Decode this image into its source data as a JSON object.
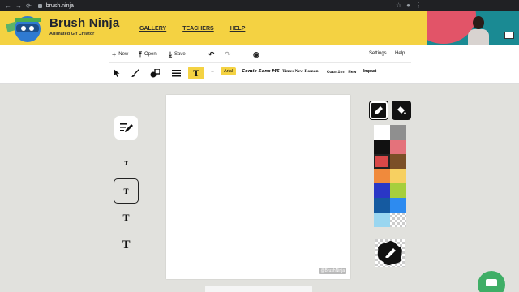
{
  "browser": {
    "url": "brush.ninja"
  },
  "brand": {
    "name": "Brush Ninja",
    "tagline": "Animated Gif Creator"
  },
  "nav": [
    {
      "label": "GALLERY"
    },
    {
      "label": "TEACHERS"
    },
    {
      "label": "HELP"
    }
  ],
  "toolbar": {
    "new_label": "New",
    "open_label": "Open",
    "save_label": "Save",
    "settings_label": "Settings",
    "help_label": "Help",
    "fonts": [
      "Arial",
      "Comic Sans MS",
      "Times New Roman",
      "Courier New",
      "Impact"
    ],
    "selected_font": "Arial"
  },
  "text_sizes": [
    "T",
    "T",
    "T",
    "T"
  ],
  "canvas": {
    "watermark": "@BrushNinja"
  },
  "palette": {
    "colors": [
      "#ffffff",
      "#8f8f8f",
      "#111111",
      "#e4727b",
      "#d94848",
      "#7b4f27",
      "#f08a3c",
      "#f7d061",
      "#2a37c6",
      "#a6cf3d",
      "#155aa0",
      "#2d8bf0",
      "#9ad6f0",
      "transparent"
    ],
    "selected_index": 4
  },
  "icons": {
    "tool_arrow": "cursor-icon",
    "tool_brush": "brush-icon",
    "tool_shapes": "shapes-icon",
    "tool_lines": "lines-icon",
    "tool_text": "text-icon"
  }
}
